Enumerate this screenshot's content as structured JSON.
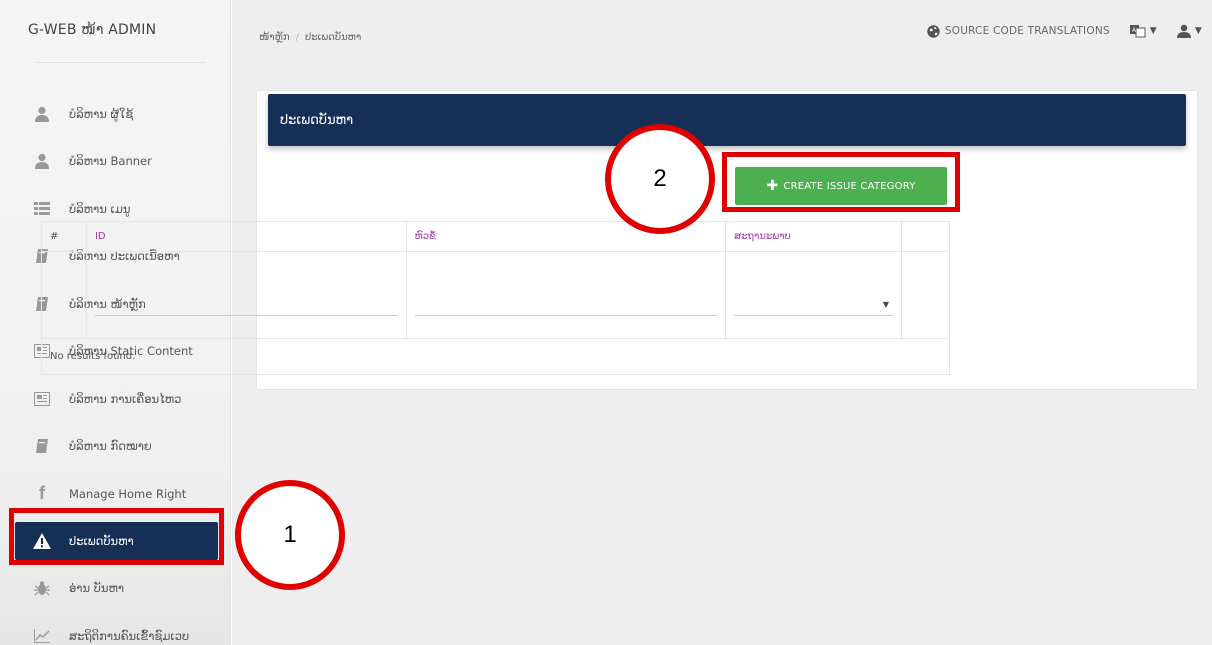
{
  "sidebar": {
    "brand": "G-WEB ໜ້າ ADMIN",
    "items": [
      {
        "label": "ບໍລິຫານ ຜູ້ໃຊ້",
        "icon": "user-icon"
      },
      {
        "label": "ບໍລິຫານ Banner",
        "icon": "user-icon"
      },
      {
        "label": "ບໍລິຫານ ເມນູ",
        "icon": "list-icon"
      },
      {
        "label": "ບໍລິຫານ ປະເພດເນື້ອຫາ",
        "icon": "book-icon"
      },
      {
        "label": "ບໍລິຫານ ໜ້າຫຼັກ",
        "icon": "book-icon"
      },
      {
        "label": "ບໍລິຫານ Static Content",
        "icon": "newspaper-icon"
      },
      {
        "label": "ບໍລິຫານ ການເຄື່ອນໄຫວ",
        "icon": "newspaper-icon"
      },
      {
        "label": "ບໍລິຫານ ກົດໝາຍ",
        "icon": "book-icon"
      },
      {
        "label": "Manage Home Right",
        "icon": "facebook-icon"
      },
      {
        "label": "ປະເພດບັນຫາ",
        "icon": "warning-icon",
        "active": true
      },
      {
        "label": "ອ່ານ ບັນຫາ",
        "icon": "bug-icon"
      },
      {
        "label": "ສະຖິຕິການຄົນເຂົ້າຊົມເວບ",
        "icon": "chart-icon"
      }
    ]
  },
  "topbar": {
    "breadcrumb": [
      "ໜ້າຫຼັກ",
      "ປະເພດບັນຫາ"
    ],
    "translations_label": "SOURCE CODE TRANSLATIONS"
  },
  "panel": {
    "title": "ປະເພດບັນຫາ",
    "create_label": "CREATE ISSUE CATEGORY"
  },
  "table": {
    "columns": [
      "#",
      "ID",
      "ຫົວຂໍ້",
      "ສະຖານະພາບ"
    ],
    "empty_text": "No results found."
  },
  "annotations": {
    "one": "1",
    "two": "2"
  },
  "colors": {
    "navy": "#162f57",
    "green": "#4caf50",
    "red": "#e00000",
    "purple": "#a23aa8"
  }
}
